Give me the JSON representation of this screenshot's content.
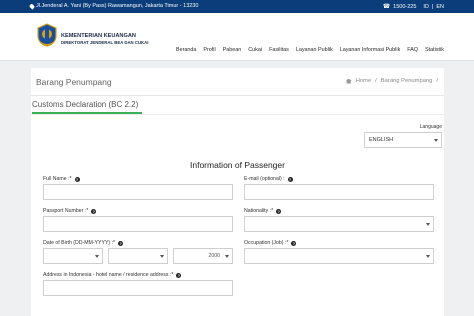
{
  "topbar": {
    "address": "Jl.Jenderal A. Yani (By Pass) Rawamangun, Jakarta Timur - 13230",
    "phone": "1500-225",
    "lang_id": "ID",
    "separator": "|",
    "lang_en": "EN"
  },
  "header": {
    "ministry_line1": "KEMENTERIAN KEUANGAN",
    "ministry_line2": "DIREKTORAT JENDERAL BEA DAN CUKAI"
  },
  "nav": {
    "items": [
      "Beranda",
      "Profil",
      "Pabean",
      "Cukai",
      "Fasilitas",
      "Layanan Publik",
      "Layanan Informasi Publik",
      "FAQ",
      "Statistik"
    ]
  },
  "page": {
    "title": "Barang Penumpang",
    "breadcrumb_home": "Home",
    "breadcrumb_sep": "/",
    "breadcrumb_current": "Barang Penumpang",
    "breadcrumb_trail": "/"
  },
  "tab": {
    "label": "Customs Declaration (BC 2.2)"
  },
  "language": {
    "label": "Language",
    "value": "ENGLISH"
  },
  "form": {
    "section_title": "Information of Passenger",
    "full_name_label": "Full Name :*",
    "email_label": "E-mail (optional) :",
    "passport_label": "Passport Number :*",
    "nationality_label": "Nationality :*",
    "dob_label": "Date of Birth (DD-MM-YYYY) :*",
    "dob_year_value": "2000",
    "occupation_label": "Occupation (Job) :*",
    "address_label": "Address in Indonesia - hotel name / residence address :*",
    "help_glyph": "?"
  },
  "colors": {
    "topbar": "#0b3d7a",
    "tab_underline": "#3daf57",
    "background": "#eef0f2"
  }
}
